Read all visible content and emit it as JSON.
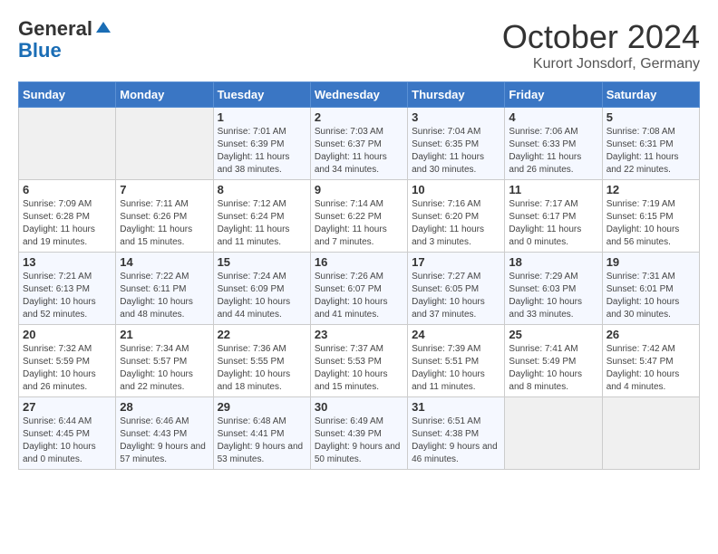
{
  "header": {
    "logo_line1": "General",
    "logo_line2": "Blue",
    "title": "October 2024",
    "location": "Kurort Jonsdorf, Germany"
  },
  "weekdays": [
    "Sunday",
    "Monday",
    "Tuesday",
    "Wednesday",
    "Thursday",
    "Friday",
    "Saturday"
  ],
  "weeks": [
    [
      {
        "day": "",
        "info": ""
      },
      {
        "day": "",
        "info": ""
      },
      {
        "day": "1",
        "info": "Sunrise: 7:01 AM\nSunset: 6:39 PM\nDaylight: 11 hours and 38 minutes."
      },
      {
        "day": "2",
        "info": "Sunrise: 7:03 AM\nSunset: 6:37 PM\nDaylight: 11 hours and 34 minutes."
      },
      {
        "day": "3",
        "info": "Sunrise: 7:04 AM\nSunset: 6:35 PM\nDaylight: 11 hours and 30 minutes."
      },
      {
        "day": "4",
        "info": "Sunrise: 7:06 AM\nSunset: 6:33 PM\nDaylight: 11 hours and 26 minutes."
      },
      {
        "day": "5",
        "info": "Sunrise: 7:08 AM\nSunset: 6:31 PM\nDaylight: 11 hours and 22 minutes."
      }
    ],
    [
      {
        "day": "6",
        "info": "Sunrise: 7:09 AM\nSunset: 6:28 PM\nDaylight: 11 hours and 19 minutes."
      },
      {
        "day": "7",
        "info": "Sunrise: 7:11 AM\nSunset: 6:26 PM\nDaylight: 11 hours and 15 minutes."
      },
      {
        "day": "8",
        "info": "Sunrise: 7:12 AM\nSunset: 6:24 PM\nDaylight: 11 hours and 11 minutes."
      },
      {
        "day": "9",
        "info": "Sunrise: 7:14 AM\nSunset: 6:22 PM\nDaylight: 11 hours and 7 minutes."
      },
      {
        "day": "10",
        "info": "Sunrise: 7:16 AM\nSunset: 6:20 PM\nDaylight: 11 hours and 3 minutes."
      },
      {
        "day": "11",
        "info": "Sunrise: 7:17 AM\nSunset: 6:17 PM\nDaylight: 11 hours and 0 minutes."
      },
      {
        "day": "12",
        "info": "Sunrise: 7:19 AM\nSunset: 6:15 PM\nDaylight: 10 hours and 56 minutes."
      }
    ],
    [
      {
        "day": "13",
        "info": "Sunrise: 7:21 AM\nSunset: 6:13 PM\nDaylight: 10 hours and 52 minutes."
      },
      {
        "day": "14",
        "info": "Sunrise: 7:22 AM\nSunset: 6:11 PM\nDaylight: 10 hours and 48 minutes."
      },
      {
        "day": "15",
        "info": "Sunrise: 7:24 AM\nSunset: 6:09 PM\nDaylight: 10 hours and 44 minutes."
      },
      {
        "day": "16",
        "info": "Sunrise: 7:26 AM\nSunset: 6:07 PM\nDaylight: 10 hours and 41 minutes."
      },
      {
        "day": "17",
        "info": "Sunrise: 7:27 AM\nSunset: 6:05 PM\nDaylight: 10 hours and 37 minutes."
      },
      {
        "day": "18",
        "info": "Sunrise: 7:29 AM\nSunset: 6:03 PM\nDaylight: 10 hours and 33 minutes."
      },
      {
        "day": "19",
        "info": "Sunrise: 7:31 AM\nSunset: 6:01 PM\nDaylight: 10 hours and 30 minutes."
      }
    ],
    [
      {
        "day": "20",
        "info": "Sunrise: 7:32 AM\nSunset: 5:59 PM\nDaylight: 10 hours and 26 minutes."
      },
      {
        "day": "21",
        "info": "Sunrise: 7:34 AM\nSunset: 5:57 PM\nDaylight: 10 hours and 22 minutes."
      },
      {
        "day": "22",
        "info": "Sunrise: 7:36 AM\nSunset: 5:55 PM\nDaylight: 10 hours and 18 minutes."
      },
      {
        "day": "23",
        "info": "Sunrise: 7:37 AM\nSunset: 5:53 PM\nDaylight: 10 hours and 15 minutes."
      },
      {
        "day": "24",
        "info": "Sunrise: 7:39 AM\nSunset: 5:51 PM\nDaylight: 10 hours and 11 minutes."
      },
      {
        "day": "25",
        "info": "Sunrise: 7:41 AM\nSunset: 5:49 PM\nDaylight: 10 hours and 8 minutes."
      },
      {
        "day": "26",
        "info": "Sunrise: 7:42 AM\nSunset: 5:47 PM\nDaylight: 10 hours and 4 minutes."
      }
    ],
    [
      {
        "day": "27",
        "info": "Sunrise: 6:44 AM\nSunset: 4:45 PM\nDaylight: 10 hours and 0 minutes."
      },
      {
        "day": "28",
        "info": "Sunrise: 6:46 AM\nSunset: 4:43 PM\nDaylight: 9 hours and 57 minutes."
      },
      {
        "day": "29",
        "info": "Sunrise: 6:48 AM\nSunset: 4:41 PM\nDaylight: 9 hours and 53 minutes."
      },
      {
        "day": "30",
        "info": "Sunrise: 6:49 AM\nSunset: 4:39 PM\nDaylight: 9 hours and 50 minutes."
      },
      {
        "day": "31",
        "info": "Sunrise: 6:51 AM\nSunset: 4:38 PM\nDaylight: 9 hours and 46 minutes."
      },
      {
        "day": "",
        "info": ""
      },
      {
        "day": "",
        "info": ""
      }
    ]
  ]
}
